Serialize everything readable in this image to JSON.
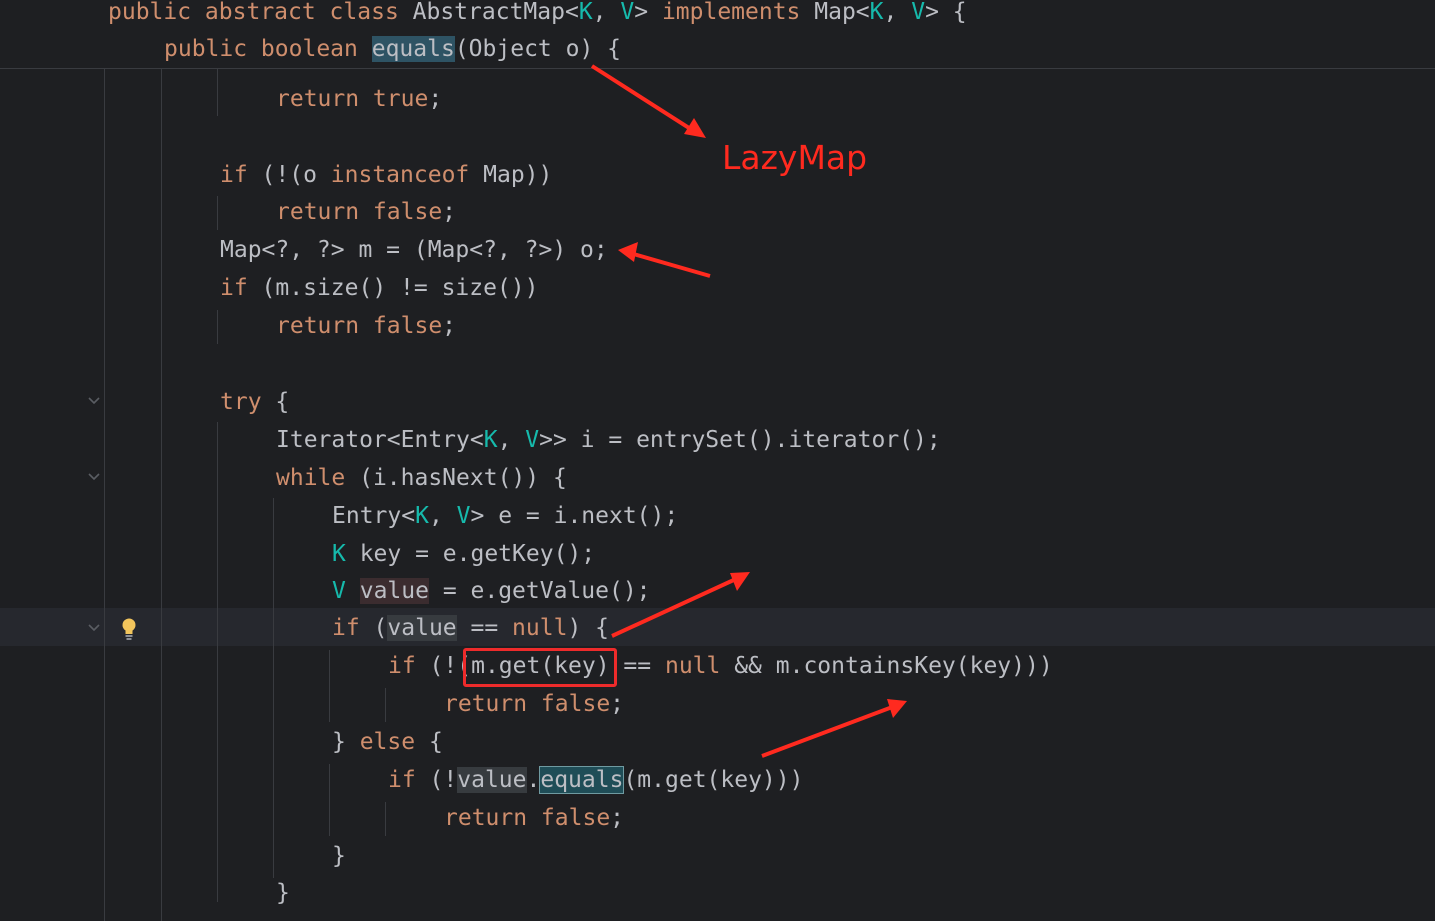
{
  "editor": {
    "sticky": {
      "class_line": {
        "kw1": "public abstract class",
        "name": " AbstractMap<",
        "K": "K",
        "comma": ", ",
        "V": "V",
        "gt": "> ",
        "kw2": "implements",
        "iface": " Map<",
        "K2": "K",
        "comma2": ", ",
        "V2": "V",
        "end": "> {"
      },
      "method_line": {
        "kw": "public boolean",
        "sp": " ",
        "fn": "equals",
        "rest": "(Object o) {"
      }
    },
    "lines": [
      {
        "a": "return true",
        "b": ";"
      },
      {
        "a": "if",
        "b": " (!(o ",
        "c": "instanceof",
        "d": " Map))"
      },
      {
        "a": "return false",
        "b": ";"
      },
      {
        "a": "Map<?, ?> m = (Map<?, ?>) o;"
      },
      {
        "a": "if",
        "b": " (m.size() != size())"
      },
      {
        "a": "return false",
        "b": ";"
      },
      {
        "a": "try",
        "b": " {"
      },
      {
        "a": "Iterator<Entry<",
        "K": "K",
        "c": ", ",
        "V": "V",
        "d": ">> i = entrySet().iterator();"
      },
      {
        "a": "while",
        "b": " (i.hasNext()) {"
      },
      {
        "a": "Entry<",
        "K": "K",
        "c": ", ",
        "V": "V",
        "d": "> e = i.next();"
      },
      {
        "K": "K",
        "a": " key = e.getKey();"
      },
      {
        "V": "V",
        "a": " ",
        "b": "value",
        "c": " = e.getValue();"
      },
      {
        "a": "if",
        "b": " (",
        "c": "value",
        "d": " == ",
        "e": "null",
        "f": ") {"
      },
      {
        "a": "if",
        "b": " (!(",
        "c": "m.get(key)",
        "d": " == ",
        "e": "null",
        "f": " && m.containsKey(key)))"
      },
      {
        "a": "return false",
        "b": ";"
      },
      {
        "a": "} ",
        "b": "else",
        "c": " {"
      },
      {
        "a": "if",
        "b": " (!",
        "c": "value",
        "d": ".",
        "e": "equals",
        "f": "(m.get(key)))"
      },
      {
        "a": "return false",
        "b": ";"
      },
      {
        "a": "}"
      },
      {
        "a": "}"
      }
    ]
  },
  "annotation": {
    "label": "LazyMap",
    "color": "#ff2a1f"
  },
  "colors": {
    "background": "#1e1f22",
    "keyword": "#cf8e6d",
    "type_param": "#16baac",
    "text": "#bcbec4"
  }
}
